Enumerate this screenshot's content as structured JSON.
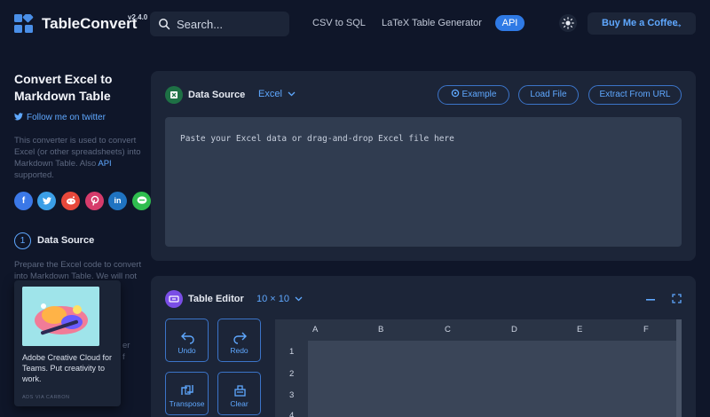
{
  "header": {
    "brand": "TableConvert",
    "version": "v2.4.0",
    "search_placeholder": "Search...",
    "nav_links": [
      "CSV to SQL",
      "LaTeX Table Generator"
    ],
    "api_label": "API",
    "coffee_label": "Buy Me a Coffee"
  },
  "sidebar": {
    "title": "Convert Excel to Markdown Table",
    "follow_label": "Follow me on twitter",
    "desc_main": "This converter is used to convert Excel (or other spreadsheets) into Markdown Table. Also ",
    "desc_api": "API",
    "desc_end": " supported.",
    "social": [
      "f",
      "t",
      "r",
      "p",
      "in",
      "l"
    ],
    "step_number": "1",
    "step_title": "Data Source",
    "step_desc": "Prepare the Excel code to convert into Markdown Table. We will not",
    "frag1": "er",
    "frag2": "f"
  },
  "ad": {
    "text": "Adobe Creative Cloud for Teams. Put creativity to work.",
    "via": "ADS VIA CARBON"
  },
  "data_source": {
    "title": "Data Source",
    "format": "Excel",
    "example_label": "Example",
    "load_label": "Load File",
    "extract_label": "Extract From URL",
    "placeholder": "Paste your Excel data or drag-and-drop Excel file here"
  },
  "table_editor": {
    "title": "Table Editor",
    "size": "10 × 10",
    "undo": "Undo",
    "redo": "Redo",
    "transpose": "Transpose",
    "clear": "Clear",
    "columns": [
      "A",
      "B",
      "C",
      "D",
      "E",
      "F"
    ],
    "rows": [
      "1",
      "2",
      "3",
      "4"
    ]
  },
  "colors": {
    "accent": "#5fa8ff",
    "background": "#0f1629",
    "card": "#1c2538",
    "excel_green": "#1e7145",
    "editor_purple": "#7a4ee6"
  }
}
